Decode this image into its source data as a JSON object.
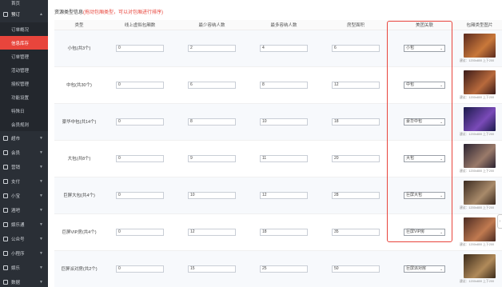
{
  "sidebar": {
    "top_item": "首页",
    "group": {
      "label": "预订"
    },
    "sub_items": [
      {
        "label": "订单概况",
        "active": false
      },
      {
        "label": "信息库存",
        "active": true
      },
      {
        "label": "订单管理",
        "active": false
      },
      {
        "label": "活动管理",
        "active": false
      },
      {
        "label": "授权管理",
        "active": false
      },
      {
        "label": "功能设置",
        "active": false
      },
      {
        "label": "特殊日",
        "active": false
      },
      {
        "label": "会员规则",
        "active": false
      }
    ],
    "groups": [
      {
        "label": "超市"
      },
      {
        "label": "会员"
      },
      {
        "label": "营销"
      },
      {
        "label": "支付"
      },
      {
        "label": "小宝"
      },
      {
        "label": "酒吧"
      },
      {
        "label": "娱乐通"
      },
      {
        "label": "公众号"
      },
      {
        "label": "小程序"
      },
      {
        "label": "娱乐"
      },
      {
        "label": "数据"
      }
    ]
  },
  "page": {
    "heading": "资源类型信息",
    "heading_note": "(拖动包厢类型，可以对包厢进行排序)"
  },
  "table": {
    "headers": [
      "类型",
      "线上虚拟包厢数",
      "最少容纳人数",
      "最多容纳人数",
      "房型面积",
      "美团关联",
      "包厢类型图片"
    ],
    "rows": [
      {
        "type": "小包(共3个)",
        "virtual": "0",
        "min": "2",
        "max": "4",
        "area": "6",
        "meituan": "小包",
        "img_caption": "建议：1200x800 上下200"
      },
      {
        "type": "中包(共30个)",
        "virtual": "0",
        "min": "6",
        "max": "8",
        "area": "12",
        "meituan": "中包",
        "img_caption": "建议：1200x800 上下200"
      },
      {
        "type": "豪华中包(共14个)",
        "virtual": "0",
        "min": "8",
        "max": "10",
        "area": "18",
        "meituan": "豪华中包",
        "img_caption": "建议：1200x800 上下200"
      },
      {
        "type": "大包(共8个)",
        "virtual": "0",
        "min": "9",
        "max": "11",
        "area": "20",
        "meituan": "大包",
        "img_caption": "建议：1200x800 上下200"
      },
      {
        "type": "巨屏大包(共4个)",
        "virtual": "0",
        "min": "10",
        "max": "12",
        "area": "28",
        "meituan": "巨屏大包",
        "img_caption": "建议：1200x800 上下200"
      },
      {
        "type": "巨屏VIP房(共4个)",
        "virtual": "0",
        "min": "12",
        "max": "18",
        "area": "35",
        "meituan": "巨屏VIP房",
        "img_caption": "建议：1200x800 上下200"
      },
      {
        "type": "巨屏派对房(共2个)",
        "virtual": "0",
        "min": "15",
        "max": "25",
        "area": "50",
        "meituan": "巨屏派对房",
        "img_caption": "建议：1200x800 上下200"
      }
    ]
  },
  "colors": {
    "accent": "#e8453c",
    "sidebar": "#2a2f36"
  },
  "icons": {
    "dropdown": "chevron-down-icon"
  }
}
